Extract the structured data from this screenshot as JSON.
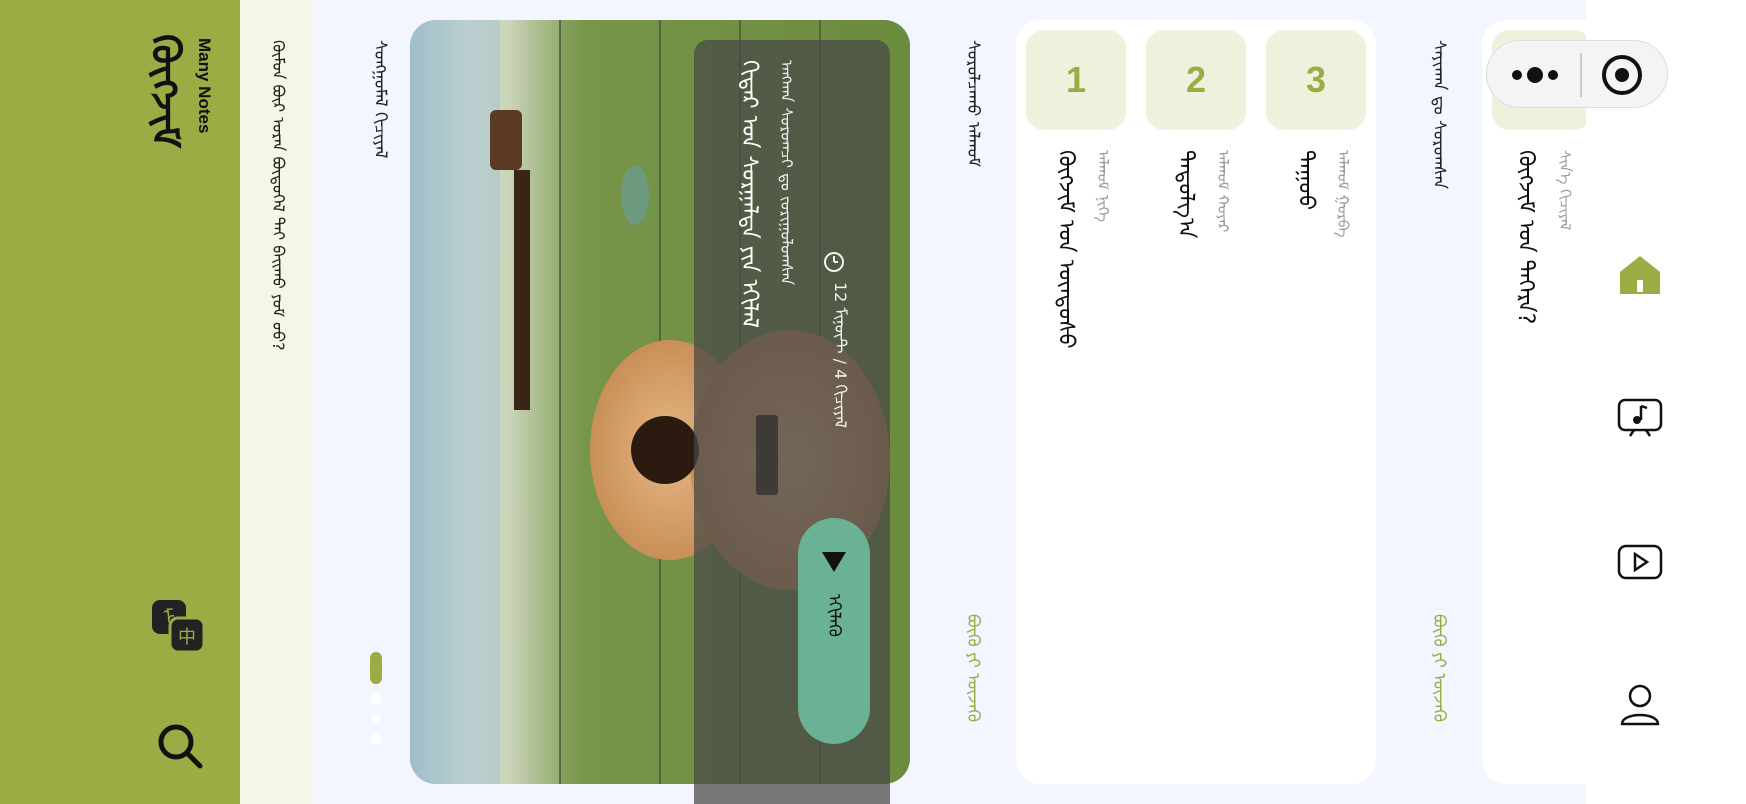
{
  "header": {
    "title": "ᠬᠥᠭᠵᠢᠮ",
    "subtitle": "Many Notes",
    "tagline": "ᠬᠦᠮᠦᠨ ᠪᠦᠷ ᠤᠷᠠᠨ ᠪᠦᠲᠦᠭᠡᠯ ᠲᠡᠢ ᠪᠠᠢᠬᠤ ᠶᠤᠮ ᠦᠦ?"
  },
  "featured": {
    "section_title": "ᠰᠣᠩᠭᠣᠮᠠᠯ ᠬᠢᠴᠢᠶᠡᠯ",
    "banner_title": "ᠭᠢᠲᠠᠷ ᠤᠨ ᠰᠤᠷᠭᠠᠯᠲᠠ ᠶᠢᠨ ᠡᠬᠢᠯᠡᠯ",
    "banner_desc": "ᠠᠩᠬᠠᠨ ᠰᠤᠷᠤᠭᠴᠢ ᠳᠤ ᠵᠣᠷᠢᠭᠣᠯᠤᠭᠰᠠᠨ",
    "duration": "12 ᠮᠢᠨᠦ᠋ᠲ / 4 ᠬᠢᠴᠢᠶᠡᠯ",
    "play_label": "ᠡᠬᠢᠯᠡᠬᠦ",
    "slide_count": 4,
    "active_slide": 1
  },
  "steps": {
    "heading": "ᠰᠤᠷᠤᠯᠴᠠᠬᠤ ᠠᠯᠬᠤᠮ",
    "more": "ᠪᠦᠬᠦ ᠶᠢ ᠦᠵᠡᠬᠦ",
    "items": [
      {
        "number": "1",
        "label": "ᠬᠦᠭᠵᠢᠮ ᠤᠨ ᠦᠨᠳᠦᠰᠦ",
        "sub": "ᠠᠯᠬᠤᠮ ᠨᠢᠭᠡ"
      },
      {
        "number": "2",
        "label": "ᠳᠠᠳᠤᠯᠭ᠎ᠠ",
        "sub": "ᠠᠯᠬᠤᠮ ᠬᠣᠶᠠᠷ"
      },
      {
        "number": "3",
        "label": "ᠳᠠᠭᠤᠤ",
        "sub": "ᠠᠯᠬᠤᠮ ᠭᠤᠷᠪᠠ"
      }
    ]
  },
  "recent": {
    "heading": "ᠰᠠᠶᠢᠬᠠᠨ ᠳᠤ ᠰᠤᠷᠤᠭᠰᠠᠨ",
    "more": "ᠪᠦᠬᠦ ᠶᠢ ᠦᠵᠡᠬᠦ",
    "item_number": "1",
    "item_label": "ᠬᠥᠭᠵᠢᠮ ᠤᠨ ᠳᠡᠭᠡᠷᠡ?",
    "item_sub": "ᠰᠢᠨ᠎ᠡ ᠬᠢᠴᠢᠶᠡᠯ"
  },
  "nav": {
    "items": [
      "home-icon",
      "music-icon",
      "video-icon",
      "profile-icon"
    ],
    "active": "home-icon"
  },
  "colors": {
    "accent": "#9dab45",
    "play": "#69b295",
    "badge_bg": "#eef1dc"
  }
}
